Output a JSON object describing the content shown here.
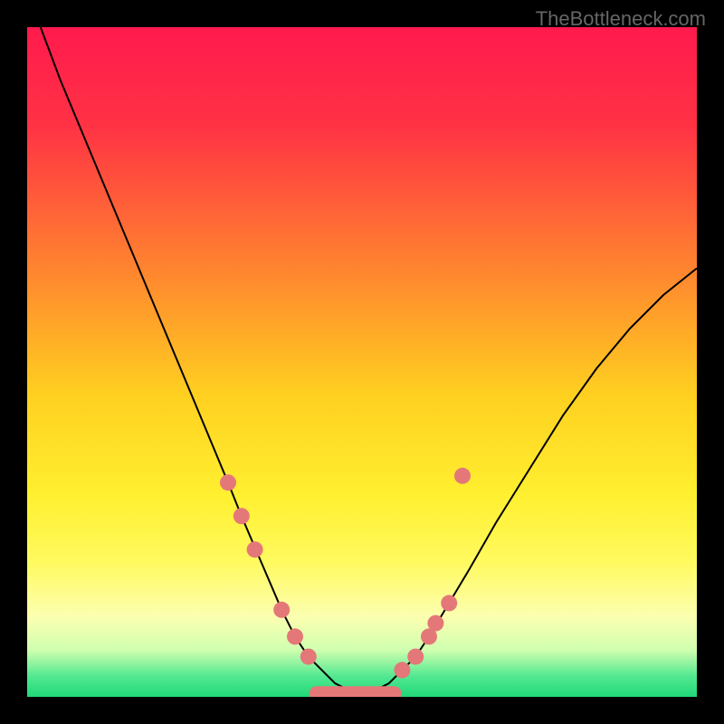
{
  "watermark": "TheBottleneck.com",
  "chart_data": {
    "type": "line",
    "title": "",
    "xlabel": "",
    "ylabel": "",
    "xlim": [
      0,
      100
    ],
    "ylim": [
      0,
      100
    ],
    "series": [
      {
        "name": "left-curve",
        "x": [
          2,
          5,
          10,
          15,
          20,
          25,
          30,
          32,
          35,
          38,
          40,
          42,
          44,
          46,
          48,
          50
        ],
        "y": [
          100,
          92,
          80,
          68,
          56,
          44,
          32,
          27,
          20,
          13,
          9,
          6,
          4,
          2,
          1,
          0
        ]
      },
      {
        "name": "right-curve",
        "x": [
          50,
          52,
          54,
          56,
          58,
          60,
          63,
          66,
          70,
          75,
          80,
          85,
          90,
          95,
          100
        ],
        "y": [
          0,
          1,
          2,
          4,
          6,
          9,
          14,
          19,
          26,
          34,
          42,
          49,
          55,
          60,
          64
        ]
      }
    ],
    "markers_left": [
      {
        "x": 30,
        "y": 32
      },
      {
        "x": 32,
        "y": 27
      },
      {
        "x": 34,
        "y": 22
      },
      {
        "x": 38,
        "y": 13
      },
      {
        "x": 40,
        "y": 9
      },
      {
        "x": 42,
        "y": 6
      }
    ],
    "markers_right": [
      {
        "x": 56,
        "y": 4
      },
      {
        "x": 58,
        "y": 6
      },
      {
        "x": 60,
        "y": 9
      },
      {
        "x": 61,
        "y": 11
      },
      {
        "x": 63,
        "y": 14
      },
      {
        "x": 65,
        "y": 33
      }
    ],
    "markers_bottom": [
      {
        "x": 44,
        "y": 0.5
      },
      {
        "x": 46,
        "y": 0.5
      },
      {
        "x": 48,
        "y": 0.5
      },
      {
        "x": 50,
        "y": 0.5
      },
      {
        "x": 52,
        "y": 0.5
      },
      {
        "x": 54,
        "y": 0.5
      }
    ],
    "gradient_stops": [
      {
        "offset": 0,
        "color": "#ff1a4d"
      },
      {
        "offset": 15,
        "color": "#ff3344"
      },
      {
        "offset": 35,
        "color": "#ff8030"
      },
      {
        "offset": 55,
        "color": "#ffd020"
      },
      {
        "offset": 70,
        "color": "#fff030"
      },
      {
        "offset": 80,
        "color": "#fffa60"
      },
      {
        "offset": 88,
        "color": "#fcffb0"
      },
      {
        "offset": 93,
        "color": "#d0ffb0"
      },
      {
        "offset": 97,
        "color": "#50e890"
      },
      {
        "offset": 100,
        "color": "#20d878"
      }
    ],
    "marker_color": "#e47878",
    "curve_color": "#000000"
  }
}
